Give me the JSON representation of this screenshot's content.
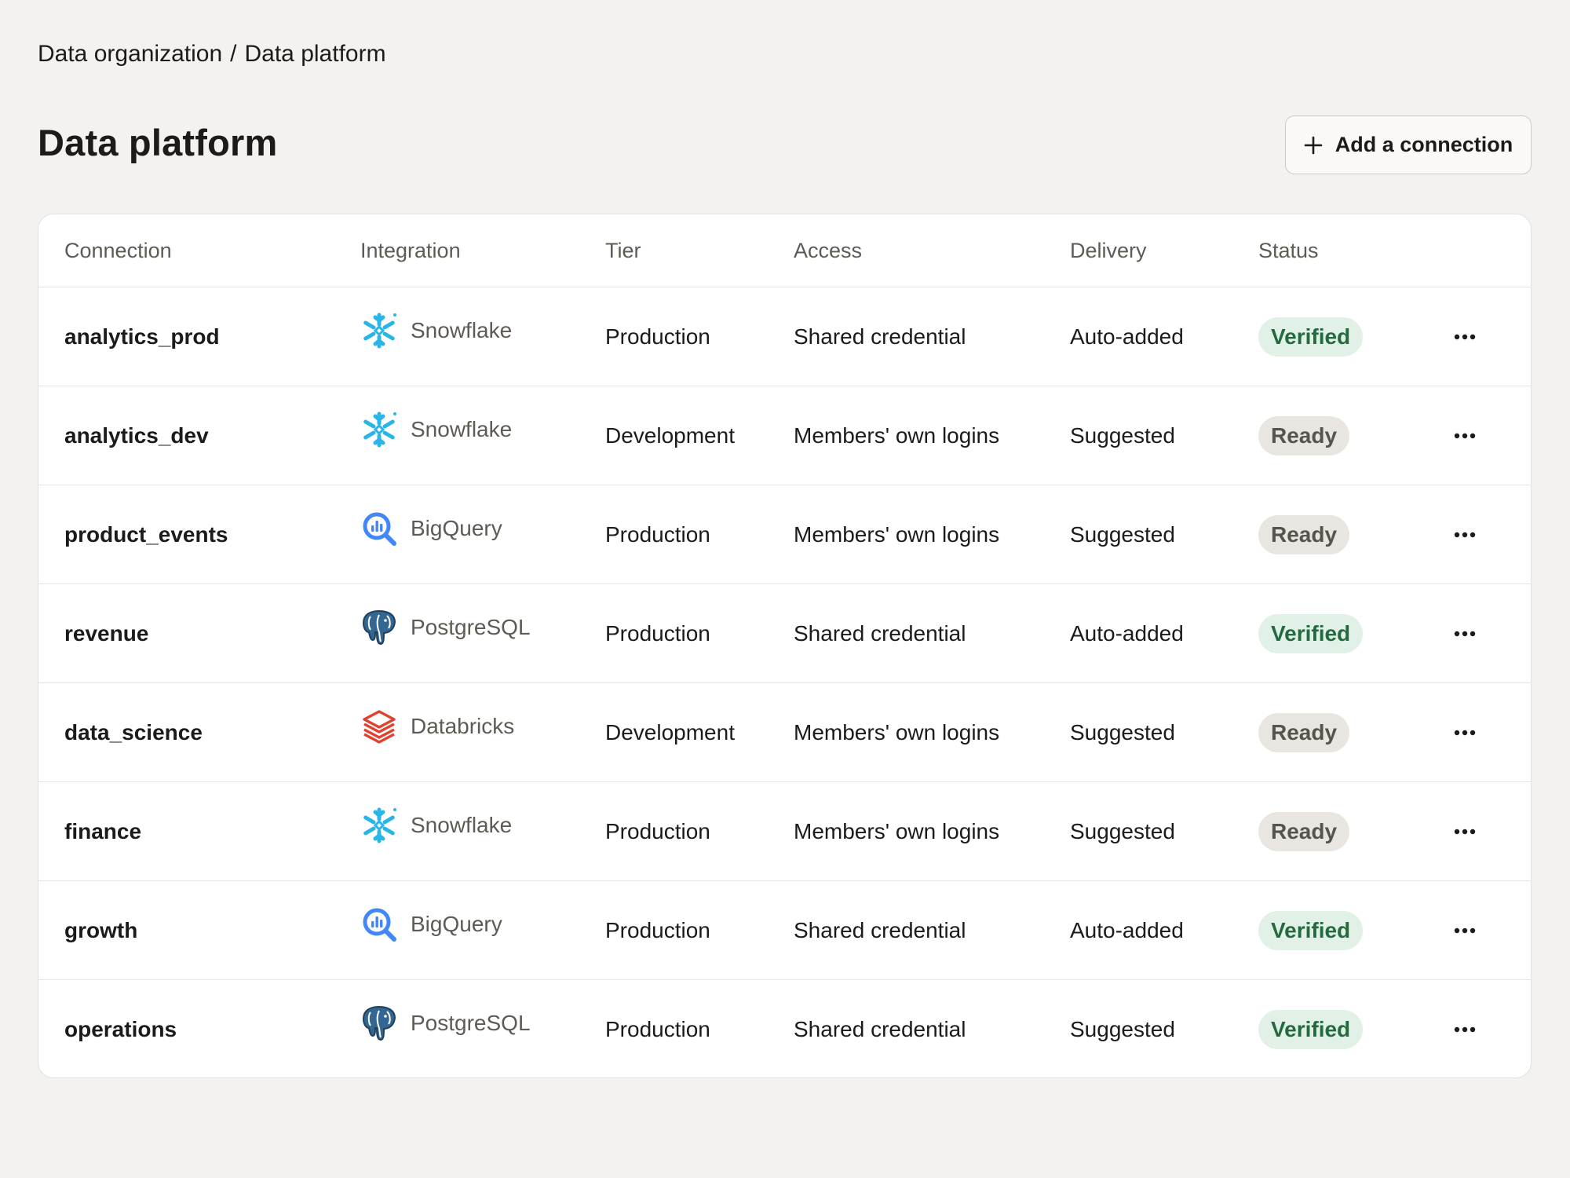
{
  "breadcrumb": {
    "parent": "Data organization",
    "separator": "/",
    "current": "Data platform"
  },
  "page_title": "Data platform",
  "add_connection_button": {
    "label": "Add a connection",
    "icon": "plus-icon"
  },
  "table": {
    "columns": [
      "Connection",
      "Integration",
      "Tier",
      "Access",
      "Delivery",
      "Status"
    ],
    "rows": [
      {
        "connection": "analytics_prod",
        "integration": "Snowflake",
        "integration_icon": "snowflake-icon",
        "tier": "Production",
        "access": "Shared credential",
        "delivery": "Auto-added",
        "status": "Verified",
        "status_kind": "verified"
      },
      {
        "connection": "analytics_dev",
        "integration": "Snowflake",
        "integration_icon": "snowflake-icon",
        "tier": "Development",
        "access": "Members' own logins",
        "delivery": "Suggested",
        "status": "Ready",
        "status_kind": "ready"
      },
      {
        "connection": "product_events",
        "integration": "BigQuery",
        "integration_icon": "bigquery-icon",
        "tier": "Production",
        "access": "Members' own logins",
        "delivery": "Suggested",
        "status": "Ready",
        "status_kind": "ready"
      },
      {
        "connection": "revenue",
        "integration": "PostgreSQL",
        "integration_icon": "postgresql-icon",
        "tier": "Production",
        "access": "Shared credential",
        "delivery": "Auto-added",
        "status": "Verified",
        "status_kind": "verified"
      },
      {
        "connection": "data_science",
        "integration": "Databricks",
        "integration_icon": "databricks-icon",
        "tier": "Development",
        "access": "Members' own logins",
        "delivery": "Suggested",
        "status": "Ready",
        "status_kind": "ready"
      },
      {
        "connection": "finance",
        "integration": "Snowflake",
        "integration_icon": "snowflake-icon",
        "tier": "Production",
        "access": "Members' own logins",
        "delivery": "Suggested",
        "status": "Ready",
        "status_kind": "ready"
      },
      {
        "connection": "growth",
        "integration": "BigQuery",
        "integration_icon": "bigquery-icon",
        "tier": "Production",
        "access": "Shared credential",
        "delivery": "Auto-added",
        "status": "Verified",
        "status_kind": "verified"
      },
      {
        "connection": "operations",
        "integration": "PostgreSQL",
        "integration_icon": "postgresql-icon",
        "tier": "Production",
        "access": "Shared credential",
        "delivery": "Suggested",
        "status": "Verified",
        "status_kind": "verified"
      }
    ],
    "row_action_icon": "more-horizontal-icon"
  },
  "colors": {
    "background": "#f3f2f0",
    "card": "#ffffff",
    "verified_bg": "#e2f1e7",
    "verified_text": "#236b3e",
    "ready_bg": "#e9e6e1",
    "ready_text": "#57534d",
    "snowflake": "#29b5e8",
    "bigquery": "#4386fa",
    "postgresql": "#336791",
    "databricks": "#e0422f"
  }
}
